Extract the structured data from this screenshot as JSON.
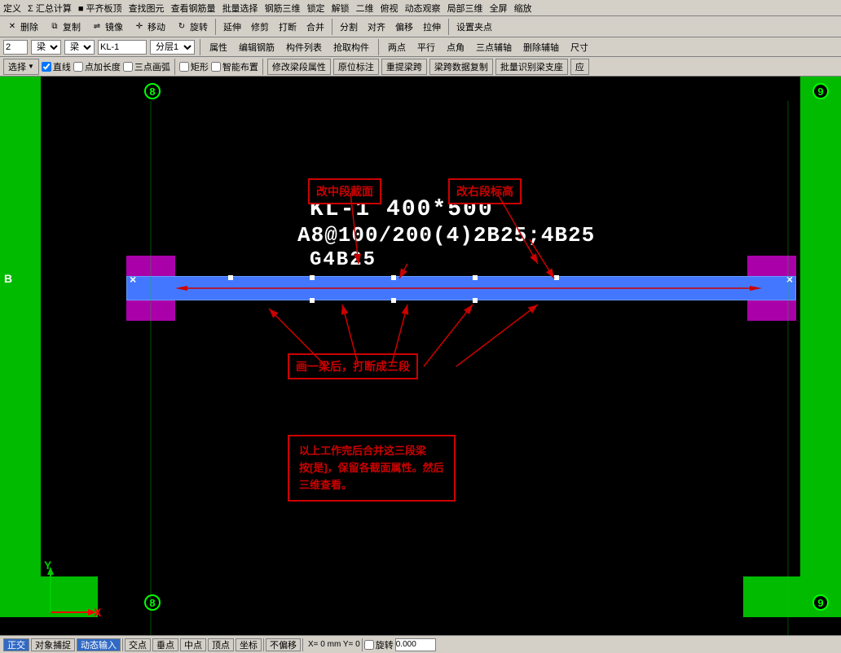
{
  "menubar": {
    "items": [
      "定义",
      "Σ 汇总计算",
      "■ 平齐板顶",
      "查找图元",
      "查看钢筋量",
      "批量选择",
      "钢筋三维",
      "锁定",
      "解锁",
      "二维",
      "俯视",
      "动态观察",
      "局部三维",
      "全屏",
      "缩放"
    ]
  },
  "toolbar1": {
    "items": [
      "删除",
      "复制",
      "镜像",
      "移动",
      "旋转",
      "延伸",
      "修剪",
      "打断",
      "合并",
      "分割",
      "对齐",
      "偏移",
      "拉伸",
      "设置夹点"
    ]
  },
  "propbar": {
    "layer_num": "2",
    "type1": "梁",
    "type2": "梁",
    "name": "KL-1",
    "layer": "分层1",
    "buttons": [
      "属性",
      "编辑钢筋",
      "构件列表",
      "抢取构件",
      "两点",
      "平行",
      "点角",
      "三点辅轴",
      "删除辅轴",
      "尺寸"
    ]
  },
  "toolbar2": {
    "items": [
      "选择",
      "直线",
      "点加长度",
      "三点画弧",
      "矩形",
      "智能布置",
      "修改梁段属性",
      "原位标注",
      "重提梁跨",
      "梁跨数据复制",
      "批量识别梁支座",
      "应"
    ]
  },
  "canvas": {
    "beam_label1": "KL-1 400*500",
    "beam_label2": "A8@100/200(4)2B25;4B25",
    "beam_label3": "G4B25",
    "annotation1": "改中段截面",
    "annotation2": "改右段标高",
    "annotation3": "画一梁后，打断成三段",
    "annotation4_line1": "以上工作完后合并这三段梁",
    "annotation4_line2": "按[是]，保留各截面属性。然后",
    "annotation4_line3": "三维查看。",
    "grid_left": "8",
    "grid_right": "9",
    "axis_b": "B",
    "x_axis": "X",
    "y_axis": "Y"
  },
  "statusbar": {
    "items": [
      "正交",
      "对象捕捉",
      "动态输入",
      "交点",
      "垂点",
      "中点",
      "顶点",
      "坐标",
      "不偏移"
    ],
    "coords": "X=  0  mm  Y=  0",
    "rotation": "旋转",
    "rotation_val": "0.000"
  },
  "colors": {
    "green": "#00cc00",
    "beam_blue": "#3366ff",
    "purple": "#9900cc",
    "annotation_red": "#cc0000",
    "label_white": "#ffffff",
    "background": "#000000"
  }
}
